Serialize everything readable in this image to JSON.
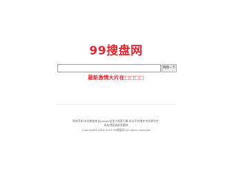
{
  "site": {
    "logo_text": "99搜盘网"
  },
  "search": {
    "placeholder": "",
    "value": "",
    "button_label": "网盘一下"
  },
  "promo": {
    "text": "最新激情大片在□□□□"
  },
  "footer": {
    "lines": [
      "免责声明:本站数据来自google自定义搜索引擎,本站不存储任何资源文件,",
      "如有侵权请联系删除",
      "Copyright©2014-2019 99搜盘网 All rights reserved"
    ]
  },
  "colors": {
    "brand": "#e8252f",
    "footer_text": "#6a6a6a"
  }
}
